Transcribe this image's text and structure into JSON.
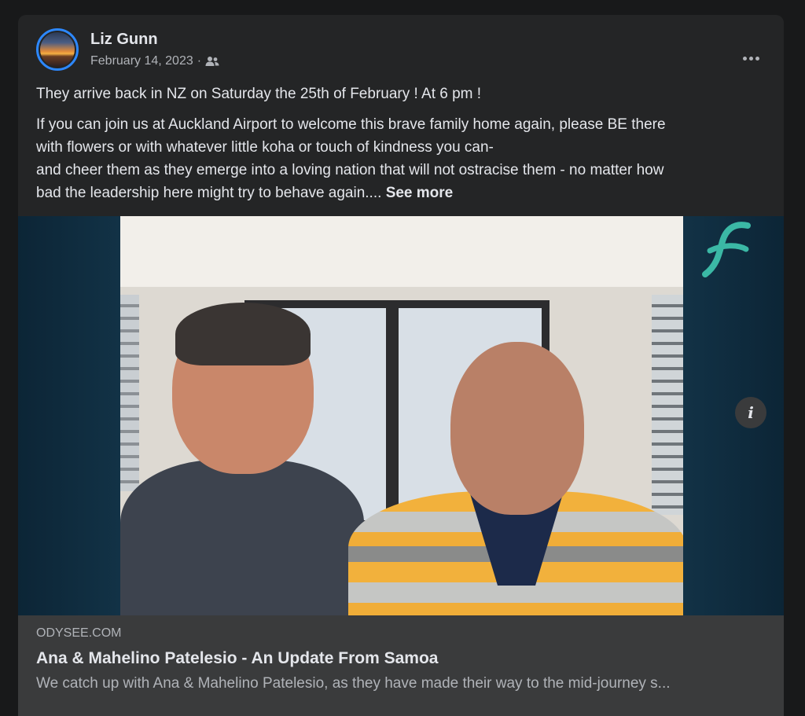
{
  "post": {
    "author": "Liz Gunn",
    "date": "February 14, 2023",
    "separator": "·",
    "audience_icon": "friends-icon",
    "paragraph1": "They arrive back in NZ on Saturday the 25th of February ! At 6 pm !",
    "paragraph2_line1": "If you can join us at Auckland Airport to welcome this brave family home again, please BE there",
    "paragraph2_line2": "with flowers or with whatever little koha or touch of kindness you can-",
    "paragraph2_line3": "and cheer them as they emerge into a loving nation that will not ostracise them - no matter how",
    "paragraph2_line4": "bad the leadership here might try to behave again....",
    "see_more": "See more"
  },
  "link_preview": {
    "domain": "ODYSEE.COM",
    "title": "Ana & Mahelino Patelesio - An Update From Samoa",
    "description": "We catch up with Ana & Mahelino Patelesio, as they have made their way to the mid-journey s..."
  },
  "colors": {
    "background": "#18191a",
    "card": "#242526",
    "link_box": "#3a3b3c",
    "accent": "#2d88ff",
    "brand_mark": "#3bb8a5"
  }
}
